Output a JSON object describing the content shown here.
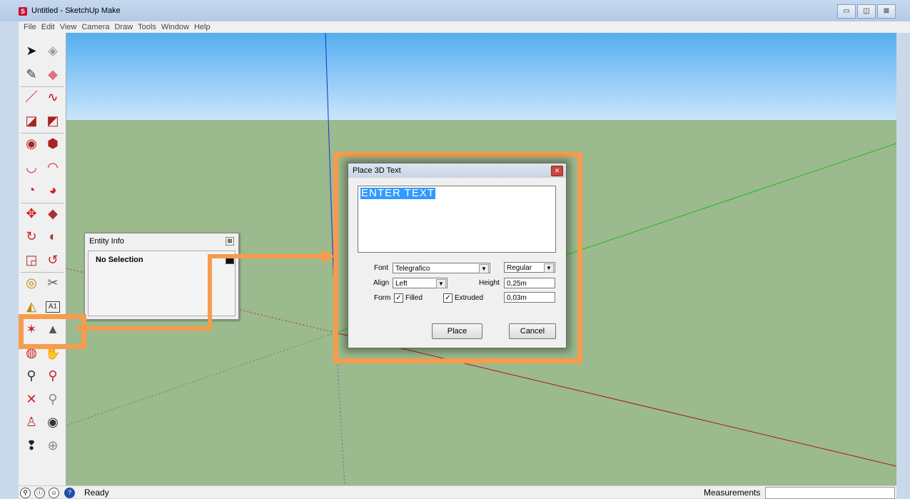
{
  "window": {
    "title": "Untitled - SketchUp Make",
    "minimize": "▭",
    "maximize": "◫",
    "close": "⊠"
  },
  "menu": [
    "File",
    "Edit",
    "View",
    "Camera",
    "Draw",
    "Tools",
    "Window",
    "Help"
  ],
  "toolbar_icons": [
    {
      "left": "select-arrow-icon",
      "right": "make-component-icon",
      "lg": "➤",
      "rg": "◈",
      "lc": "#111",
      "rc": "#999"
    },
    {
      "left": "paint-bucket-icon",
      "right": "eraser-icon",
      "lg": "✎",
      "rg": "◆",
      "lc": "#333",
      "rc": "#e07080"
    },
    {
      "left": "pencil-line-icon",
      "right": "freehand-icon",
      "lg": "／",
      "rg": "∿",
      "lc": "#c00",
      "rc": "#c00"
    },
    {
      "left": "rectangle-icon",
      "right": "rotated-rectangle-icon",
      "lg": "◪",
      "rg": "◩",
      "lc": "#a22",
      "rc": "#a22"
    },
    {
      "left": "circle-icon",
      "right": "polygon-icon",
      "lg": "◉",
      "rg": "⬢",
      "lc": "#a22",
      "rc": "#a22"
    },
    {
      "left": "arc-icon",
      "right": "two-point-arc-icon",
      "lg": "◡",
      "rg": "◠",
      "lc": "#c22",
      "rc": "#c22"
    },
    {
      "left": "three-point-arc-icon",
      "right": "pie-icon",
      "lg": "◔",
      "rg": "◕",
      "lc": "#c22",
      "rc": "#c22"
    },
    {
      "left": "move-icon",
      "right": "push-pull-icon",
      "lg": "✥",
      "rg": "◆",
      "lc": "#c22",
      "rc": "#a33"
    },
    {
      "left": "rotate-icon",
      "right": "follow-me-icon",
      "lg": "↻",
      "rg": "◐",
      "lc": "#c22",
      "rc": "#a33"
    },
    {
      "left": "scale-icon",
      "right": "offset-icon",
      "lg": "◲",
      "rg": "↺",
      "lc": "#a33",
      "rc": "#c22"
    },
    {
      "left": "tape-measure-icon",
      "right": "dimension-icon",
      "lg": "◎",
      "rg": "✂",
      "lc": "#b80",
      "rc": "#555"
    },
    {
      "left": "protractor-icon",
      "right": "text-label-icon",
      "lg": "◭",
      "rg": "A1",
      "lc": "#b80",
      "rc": "#333"
    },
    {
      "left": "axes-icon",
      "right": "3d-text-icon",
      "lg": "✶",
      "rg": "▲",
      "lc": "#c22",
      "rc": "#555"
    },
    {
      "left": "orbit-icon",
      "right": "pan-icon",
      "lg": "◍",
      "rg": "✋",
      "lc": "#c22",
      "rc": "#555"
    },
    {
      "left": "zoom-icon",
      "right": "zoom-window-icon",
      "lg": "⚲",
      "rg": "⚲",
      "lc": "#333",
      "rc": "#c22"
    },
    {
      "left": "zoom-extents-icon",
      "right": "previous-view-icon",
      "lg": "✕",
      "rg": "⚲",
      "lc": "#c22",
      "rc": "#888"
    },
    {
      "left": "position-camera-icon",
      "right": "look-around-icon",
      "lg": "♙",
      "rg": "◉",
      "lc": "#a33",
      "rc": "#333"
    },
    {
      "left": "walk-icon",
      "right": "section-plane-icon",
      "lg": "❢",
      "rg": "⊕",
      "lc": "#222",
      "rc": "#888"
    }
  ],
  "entity_info": {
    "title": "Entity Info",
    "close": "⊠",
    "selection": "No Selection"
  },
  "dialog": {
    "title": "Place 3D Text",
    "close": "✕",
    "text": "ENTER TEXT",
    "font_label": "Font",
    "font_value": "Telegrafico",
    "style_value": "Regular",
    "align_label": "Align",
    "align_value": "Left",
    "height_label": "Height",
    "height_value": "0,25m",
    "form_label": "Form",
    "filled_label": "Filled",
    "filled_checked": "✓",
    "extruded_label": "Extruded",
    "extruded_checked": "✓",
    "extrude_value": "0,03m",
    "dropdown_arrow": "▼",
    "place_label": "Place",
    "cancel_label": "Cancel"
  },
  "statusbar": {
    "icons": [
      "geo-location-icon",
      "credits-icon",
      "sign-in-icon",
      "help-icon"
    ],
    "icon_glyphs": [
      "⚲",
      "ⓘ",
      "☺",
      "?"
    ],
    "status": "Ready",
    "measurements_label": "Measurements",
    "measurements_value": ""
  },
  "colors": {
    "accent": "#f69c4d",
    "sky": "#55aef0",
    "ground": "#9bba8e",
    "selection": "#3399ff"
  }
}
